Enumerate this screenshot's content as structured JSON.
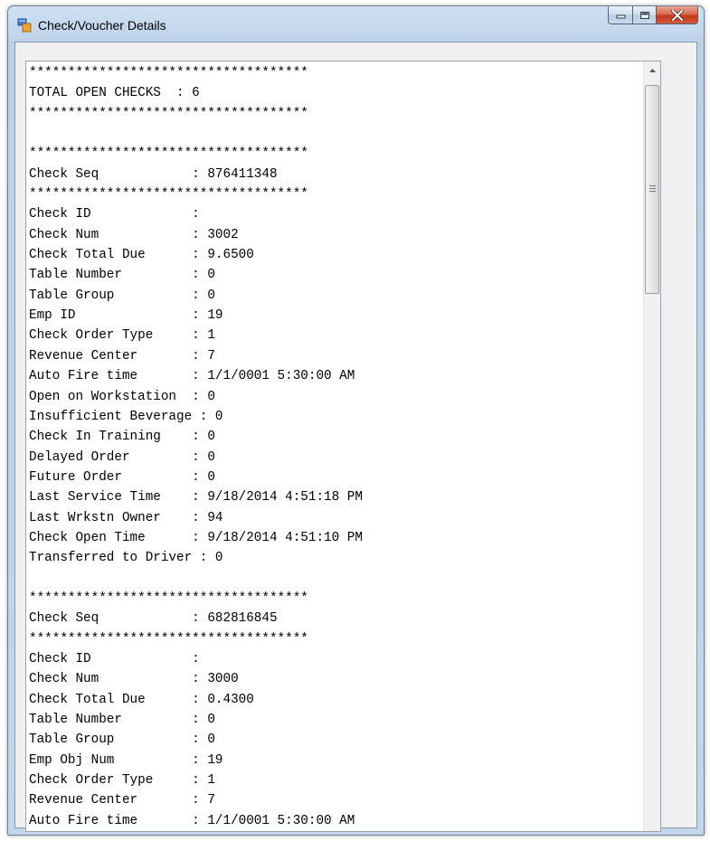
{
  "window": {
    "title": "Check/Voucher Details",
    "icon": "window-app-icon",
    "controls": [
      "minimize-icon",
      "maximize-icon",
      "close-icon"
    ]
  },
  "textbox": {
    "lines": [
      "************************************",
      "TOTAL OPEN CHECKS  : 6",
      "************************************",
      "",
      "************************************",
      "Check Seq            : 876411348",
      "************************************",
      "Check ID             :",
      "Check Num            : 3002",
      "Check Total Due      : 9.6500",
      "Table Number         : 0",
      "Table Group          : 0",
      "Emp ID               : 19",
      "Check Order Type     : 1",
      "Revenue Center       : 7",
      "Auto Fire time       : 1/1/0001 5:30:00 AM",
      "Open on Workstation  : 0",
      "Insufficient Beverage : 0",
      "Check In Training    : 0",
      "Delayed Order        : 0",
      "Future Order         : 0",
      "Last Service Time    : 9/18/2014 4:51:18 PM",
      "Last Wrkstn Owner    : 94",
      "Check Open Time      : 9/18/2014 4:51:10 PM",
      "Transferred to Driver : 0",
      "",
      "************************************",
      "Check Seq            : 682816845",
      "************************************",
      "Check ID             :",
      "Check Num            : 3000",
      "Check Total Due      : 0.4300",
      "Table Number         : 0",
      "Table Group          : 0",
      "Emp Obj Num          : 19",
      "Check Order Type     : 1",
      "Revenue Center       : 7",
      "Auto Fire time       : 1/1/0001 5:30:00 AM"
    ]
  },
  "scrollbar": {
    "up_icon": "scroll-up-arrow-icon",
    "grip_icon": "scroll-grip-icon"
  },
  "colors": {
    "frame": "#c2d6ec",
    "close_button": "#c2391c",
    "text": "#000000",
    "background": "#ffffff"
  }
}
